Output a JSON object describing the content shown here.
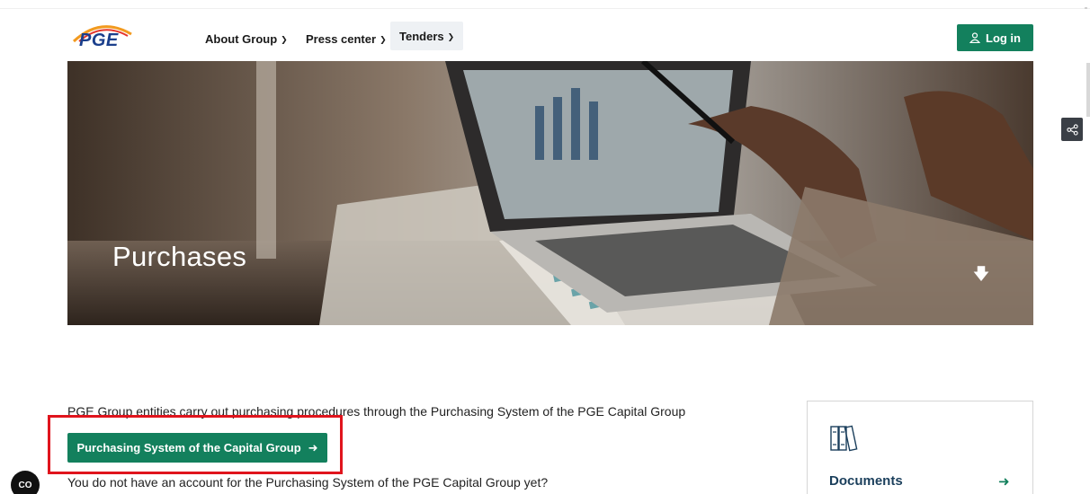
{
  "header": {
    "logo_text": "PGE",
    "nav": [
      {
        "label": "About Group"
      },
      {
        "label": "Press center"
      },
      {
        "label": "Tenders"
      }
    ],
    "login_label": "Log in"
  },
  "hero": {
    "title": "Purchases",
    "scroll_icon": "arrow-down-icon"
  },
  "share": {
    "icon": "share-icon"
  },
  "content": {
    "intro": "PGE Group entities carry out purchasing procedures through the Purchasing System of the PGE Capital Group",
    "purchasing_button": "Purchasing System of the Capital Group",
    "account_question": "You do not have an account for the Purchasing System of the PGE Capital Group yet?"
  },
  "sidebar_card": {
    "label": "Documents",
    "icon": "binders-icon"
  },
  "cookie_badge": {
    "label": "CO"
  },
  "colors": {
    "accent_green": "#13805d",
    "brand_blue": "#1b3f8c",
    "highlight_red": "#e0141d"
  }
}
